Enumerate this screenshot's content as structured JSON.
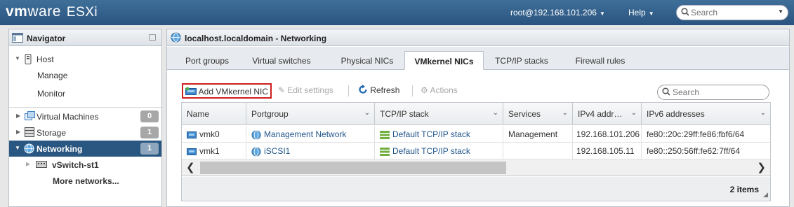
{
  "app": {
    "logo_vm": "vm",
    "logo_ware": "ware",
    "logo_esxi": "ESXi",
    "user": "root@192.168.101.206",
    "help": "Help",
    "search_placeholder": "Search"
  },
  "navigator": {
    "title": "Navigator",
    "items": [
      {
        "label": "Host",
        "icon": "host-icon"
      },
      {
        "label": "Manage"
      },
      {
        "label": "Monitor"
      },
      {
        "label": "Virtual Machines",
        "badge": "0",
        "icon": "virtual-machines-icon"
      },
      {
        "label": "Storage",
        "badge": "1",
        "icon": "storage-icon"
      },
      {
        "label": "Networking",
        "badge": "1",
        "icon": "networking-icon",
        "selected": true
      },
      {
        "label": "vSwitch-st1",
        "icon": "vswitch-icon"
      },
      {
        "label": "More networks..."
      }
    ]
  },
  "main": {
    "title": "localhost.localdomain - Networking",
    "tabs": [
      {
        "label": "Port groups"
      },
      {
        "label": "Virtual switches"
      },
      {
        "label": "Physical NICs"
      },
      {
        "label": "VMkernel NICs",
        "active": true
      },
      {
        "label": "TCP/IP stacks"
      },
      {
        "label": "Firewall rules"
      }
    ],
    "toolbar": {
      "add": "Add VMkernel NIC",
      "edit": "Edit settings",
      "refresh": "Refresh",
      "actions": "Actions",
      "search_placeholder": "Search"
    },
    "table": {
      "columns": [
        "Name",
        "Portgroup",
        "TCP/IP stack",
        "Services",
        "IPv4 addr…",
        "IPv6 addresses"
      ],
      "rows": [
        {
          "name": "vmk0",
          "portgroup": "Management Network",
          "stack": "Default TCP/IP stack",
          "services": "Management",
          "ipv4": "192.168.101.206",
          "ipv6": "fe80::20c:29ff:fe86:fbf6/64"
        },
        {
          "name": "vmk1",
          "portgroup": "iSCSI1",
          "stack": "Default TCP/IP stack",
          "services": "",
          "ipv4": "192.168.105.11",
          "ipv6": "fe80::250:56ff:fe62:7ff/64"
        }
      ],
      "count": "2 items"
    }
  },
  "colors": {
    "topbar": "#2a5480",
    "selected": "#2a5781",
    "link": "#23578b",
    "highlight_box": "#cc1d1d"
  }
}
